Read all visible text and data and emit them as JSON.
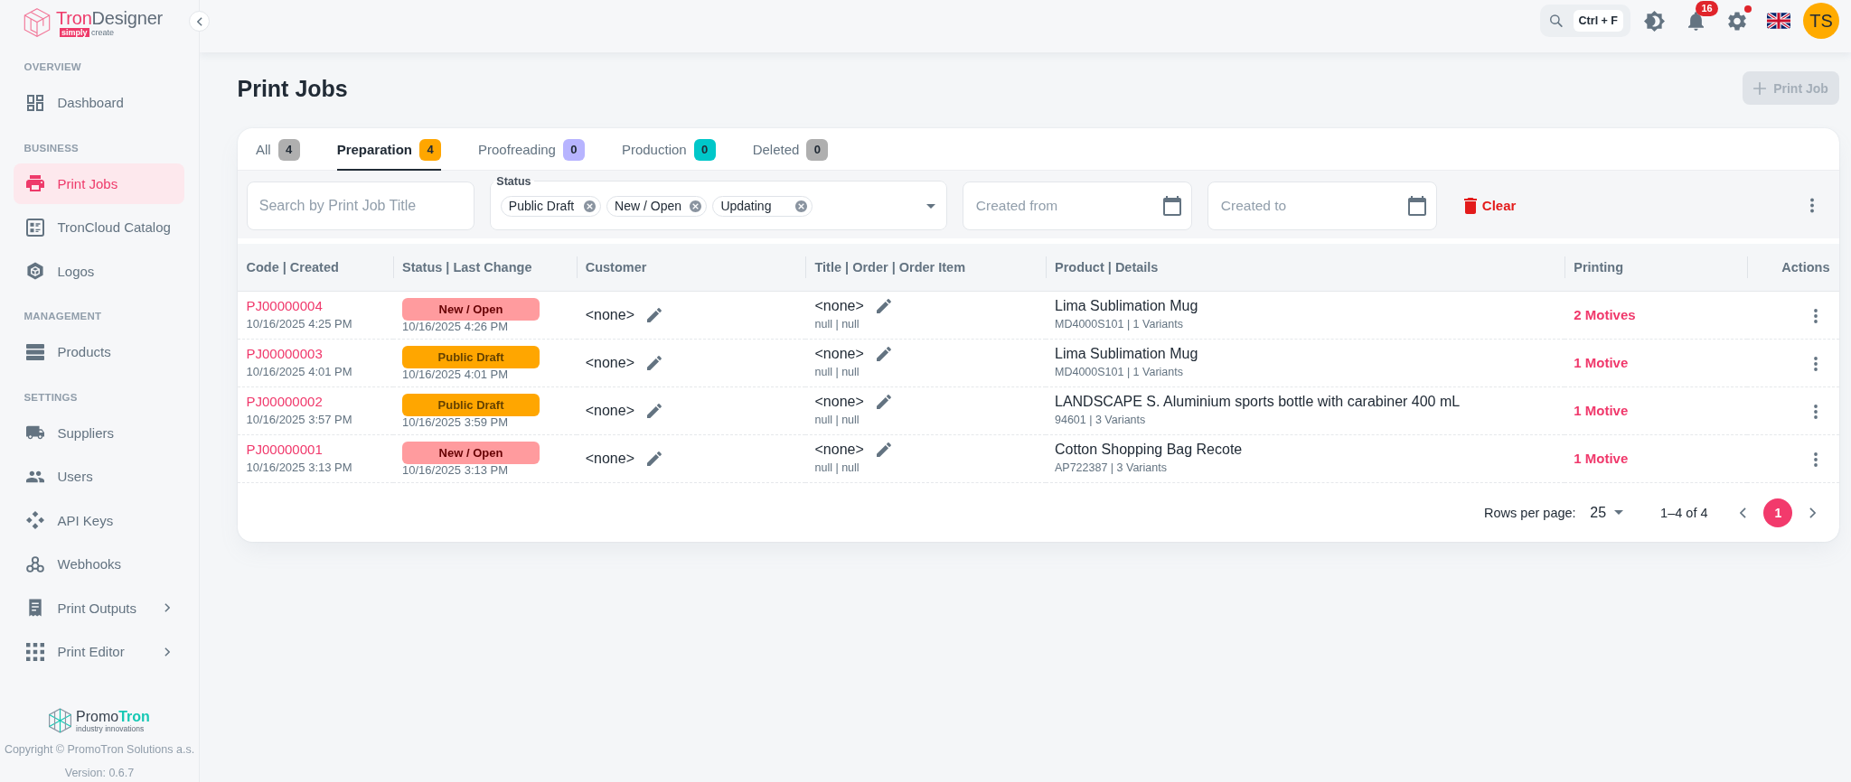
{
  "sidebar": {
    "logo": {
      "wordmark": [
        "Tron",
        "Designer"
      ],
      "tagline": [
        "simply",
        "create"
      ]
    },
    "sections": [
      {
        "label": "OVERVIEW",
        "items": [
          {
            "label": "Dashboard",
            "kind": "link",
            "selected": false
          }
        ]
      },
      {
        "label": "BUSINESS",
        "items": [
          {
            "label": "Print Jobs",
            "kind": "link",
            "selected": true
          },
          {
            "label": "TronCloud Catalog",
            "kind": "link",
            "selected": false
          },
          {
            "label": "Logos",
            "kind": "link",
            "selected": false
          }
        ]
      },
      {
        "label": "MANAGEMENT",
        "items": [
          {
            "label": "Products",
            "kind": "link",
            "selected": false
          }
        ]
      },
      {
        "label": "SETTINGS",
        "items": [
          {
            "label": "Suppliers",
            "kind": "link",
            "selected": false
          },
          {
            "label": "Users",
            "kind": "link",
            "selected": false
          },
          {
            "label": "API Keys",
            "kind": "link",
            "selected": false
          },
          {
            "label": "Webhooks",
            "kind": "link",
            "selected": false
          },
          {
            "label": "Print Outputs",
            "kind": "group",
            "selected": false
          },
          {
            "label": "Print Editor",
            "kind": "group",
            "selected": false
          }
        ]
      }
    ],
    "footer": {
      "logo": {
        "wordmark": [
          "Promo",
          "Tron"
        ],
        "tagline": "industry innovations"
      },
      "copyright": "Copyright © PromoTron Solutions a.s.",
      "version": "Version: 0.6.7"
    }
  },
  "topbar": {
    "search": {
      "shortcut": "Ctrl + F"
    },
    "notifications": {
      "count": "16"
    },
    "settings": {
      "alert": true
    },
    "avatar": {
      "initials": "TS"
    }
  },
  "page": {
    "title": "Print Jobs",
    "new_button": {
      "label": "Print Job",
      "disabled": true
    }
  },
  "tabs": [
    {
      "label": "All",
      "count": "4",
      "color": "#afafaf",
      "selected": false
    },
    {
      "label": "Preparation",
      "count": "4",
      "color": "#ffa600",
      "selected": true
    },
    {
      "label": "Proofreading",
      "count": "0",
      "color": "#b7b4ff",
      "selected": false
    },
    {
      "label": "Production",
      "count": "0",
      "color": "#00c7c9",
      "selected": false
    },
    {
      "label": "Deleted",
      "count": "0",
      "color": "#afafaf",
      "selected": false
    }
  ],
  "filters": {
    "search": {
      "placeholder": "Search by Print Job Title"
    },
    "status": {
      "label": "Status",
      "chips": [
        "Public Draft",
        "New / Open",
        "Updating"
      ]
    },
    "created_from": {
      "placeholder": "Created from"
    },
    "created_to": {
      "placeholder": "Created to"
    },
    "clear": "Clear"
  },
  "table": {
    "columns": [
      "Code | Created",
      "Status | Last Change",
      "Customer",
      "Title | Order | Order Item",
      "Product | Details",
      "Printing",
      "Actions"
    ],
    "rows": [
      {
        "code": "PJ00000004",
        "created": "10/16/2025 4:25 PM",
        "status": {
          "label": "New / Open",
          "color": "#ff9b9e"
        },
        "last_change": "10/16/2025 4:26 PM",
        "customer": "<none>",
        "title": "<none>",
        "order_item": "null | null",
        "product": "Lima Sublimation Mug",
        "details": "MD4000S101 | 1 Variants",
        "printing": "2 Motives"
      },
      {
        "code": "PJ00000003",
        "created": "10/16/2025 4:01 PM",
        "status": {
          "label": "Public Draft",
          "color": "#ffa600"
        },
        "last_change": "10/16/2025 4:01 PM",
        "customer": "<none>",
        "title": "<none>",
        "order_item": "null | null",
        "product": "Lima Sublimation Mug",
        "details": "MD4000S101 | 1 Variants",
        "printing": "1 Motive"
      },
      {
        "code": "PJ00000002",
        "created": "10/16/2025 3:57 PM",
        "status": {
          "label": "Public Draft",
          "color": "#ffa600"
        },
        "last_change": "10/16/2025 3:59 PM",
        "customer": "<none>",
        "title": "<none>",
        "order_item": "null | null",
        "product": "LANDSCAPE S. Aluminium sports bottle with carabiner 400 mL",
        "details": "94601 | 3 Variants",
        "printing": "1 Motive"
      },
      {
        "code": "PJ00000001",
        "created": "10/16/2025 3:13 PM",
        "status": {
          "label": "New / Open",
          "color": "#ff9b9e"
        },
        "last_change": "10/16/2025 3:13 PM",
        "customer": "<none>",
        "title": "<none>",
        "order_item": "null | null",
        "product": "Cotton Shopping Bag Recote",
        "details": "AP722387 | 3 Variants",
        "printing": "1 Motive"
      }
    ]
  },
  "pagination": {
    "rows_per_page_label": "Rows per page:",
    "rows_per_page": "25",
    "range": "1–4 of 4",
    "pages": [
      {
        "label": "1",
        "selected": true
      }
    ]
  }
}
